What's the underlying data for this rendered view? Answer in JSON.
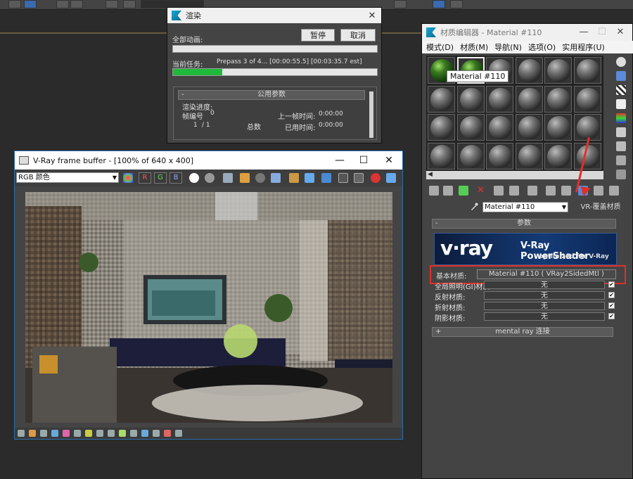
{
  "render": {
    "title": "渲染",
    "all_anim_label": "全部动画:",
    "pause_label": "暂停",
    "cancel_label": "取消",
    "current_task_label": "当前任务:",
    "current_task_value": "Prepass 3 of 4... [00:00:55.5] [00:03:35.7 est]",
    "progress_fraction": 0.24,
    "common_params": "公用参数",
    "render_progress": "渲染进度:",
    "frame_label": "帧编号",
    "frame_value": "0",
    "frame_count": "1",
    "frame_total_sep": "/ 1",
    "total_label": "总数",
    "last_frame_label": "上一帧时间:",
    "last_frame_value": "0:00:00",
    "elapsed_label": "已用时间:",
    "elapsed_value": "0:00:00"
  },
  "vfb": {
    "title": "V-Ray frame buffer - [100% of 640 x 400]",
    "channel": "RGB 颜色",
    "r": "R",
    "g": "G",
    "b": "B"
  },
  "mated": {
    "title": "材质编辑器 - Material #110",
    "menu": [
      "模式(D)",
      "材质(M)",
      "导航(N)",
      "选项(O)",
      "实用程序(U)"
    ],
    "tooltip": "Material #110",
    "material_name": "Material #110",
    "material_type": "VR-覆盖材质",
    "params_title": "参数",
    "vray_logo": "v·ray",
    "powershader": "V-Ray PowerShader",
    "optimized": "optimized for V-Ray",
    "base_label": "基本材质:",
    "base_value": "Material #110 ( VRay2SidedMtl )",
    "rows": [
      {
        "label": "全局照明(GI)材质:",
        "value": "无"
      },
      {
        "label": "反射材质:",
        "value": "无"
      },
      {
        "label": "折射材质:",
        "value": "无"
      },
      {
        "label": "阴影材质:",
        "value": "无"
      }
    ],
    "check_mark": "✔",
    "mray_title": "mental ray 连接",
    "rollout_minus": "-",
    "rollout_plus": "+"
  }
}
